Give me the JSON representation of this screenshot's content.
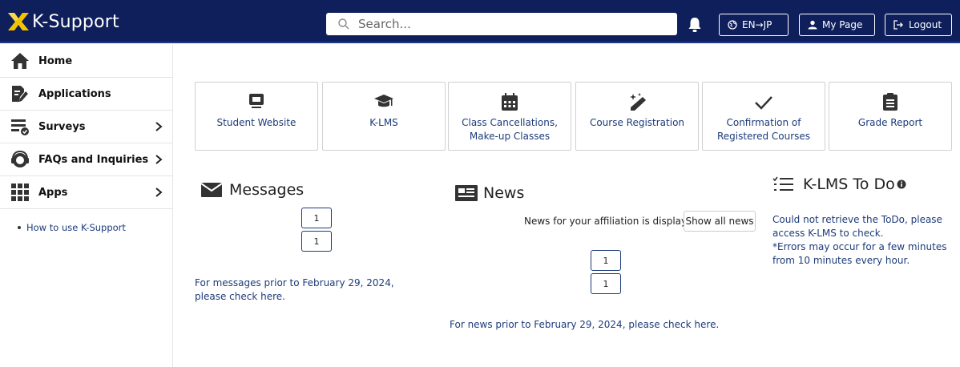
{
  "header": {
    "app_title": "K-Support",
    "search_placeholder": "Search...",
    "lang_button": "EN→JP",
    "mypage_button": "My Page",
    "logout_button": "Logout"
  },
  "sidebar": {
    "items": [
      {
        "label": "Home",
        "icon": "home-icon",
        "has_chevron": false
      },
      {
        "label": "Applications",
        "icon": "application-form-icon",
        "has_chevron": false
      },
      {
        "label": "Surveys",
        "icon": "survey-check-icon",
        "has_chevron": true
      },
      {
        "label": "FAQs and Inquiries",
        "icon": "headset-icon",
        "has_chevron": true
      },
      {
        "label": "Apps",
        "icon": "app-grid-icon",
        "has_chevron": true
      }
    ],
    "help_link": "How to use K-Support"
  },
  "tiles": [
    {
      "label": "Student Website",
      "icon": "monitor-icon"
    },
    {
      "label": "K-LMS",
      "icon": "graduation-cap-icon"
    },
    {
      "label": "Class Cancellations, Make-up Classes",
      "icon": "calendar-icon"
    },
    {
      "label": "Course Registration",
      "icon": "pencil-sparkle-icon"
    },
    {
      "label": "Confirmation of Registered Courses",
      "icon": "checkmark-icon"
    },
    {
      "label": "Grade Report",
      "icon": "clipboard-icon"
    }
  ],
  "messages": {
    "title": "Messages",
    "pager": [
      "1",
      "1"
    ],
    "archive_link": "For messages prior to February 29, 2024, please check here."
  },
  "news": {
    "title": "News",
    "affiliation_note": "News for your affiliation is displayed.",
    "show_all_button": "Show all news",
    "pager": [
      "1",
      "1"
    ],
    "archive_link": "For news prior to February 29, 2024, please check here."
  },
  "todo": {
    "title": "K-LMS To Do",
    "message_line1": "Could not retrieve the ToDo, please access K-LMS to check.",
    "message_line2": "*Errors may occur for a few minutes from 10 minutes every hour."
  },
  "colors": {
    "header_bg": "#0f1f5c",
    "link": "#1d3b7a",
    "logo_accent": "#f5c400"
  }
}
